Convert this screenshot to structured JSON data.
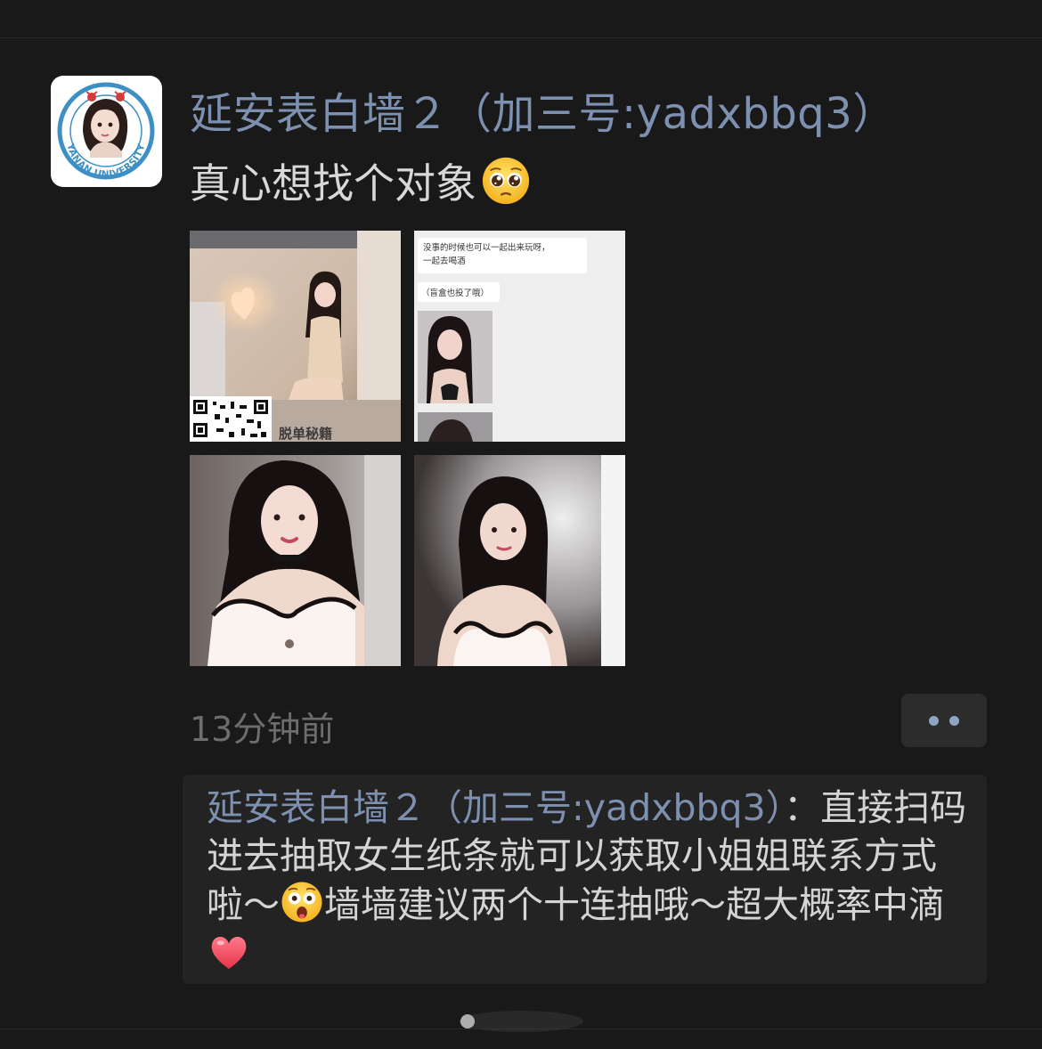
{
  "post": {
    "author": "延安表白墙２（加三号:yadxbbq3）",
    "text": "真心想找个对象",
    "text_emoji": "pleading-face-icon",
    "timestamp": "13分钟前",
    "photos": [
      {
        "label": "photo-1"
      },
      {
        "label": "photo-2"
      },
      {
        "label": "photo-3"
      },
      {
        "label": "photo-4"
      }
    ],
    "photo1_text": "脱单秘籍",
    "photo2_chat": [
      "没事的时候也可以一起出来玩呀，",
      "一起去喝酒",
      "（盲盒也投了哦）"
    ]
  },
  "avatar": {
    "badge_text": "YANAN UNIVERSITY"
  },
  "comment": {
    "commenter": "延安表白墙２（加三号:yadxbbq3）",
    "separator": "：",
    "part1": "直接扫码进去抽取女生纸条就可以获取小姐姐联系方式啦～",
    "part2": "墙墙建议两个十连抽哦～超大概率中滴",
    "emoji1": "astonished-face-icon",
    "emoji2": "red-heart-icon"
  },
  "colors": {
    "background": "#191919",
    "name_link": "#7d90b0",
    "text": "#d8d8d8",
    "muted": "#6d6d6d",
    "comment_bg": "#232323"
  }
}
